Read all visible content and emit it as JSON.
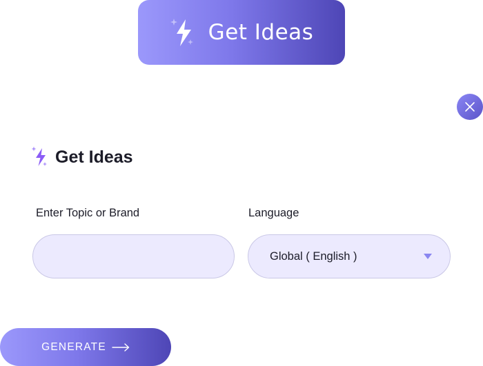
{
  "launcher": {
    "label": "Get Ideas",
    "icon": "sparkle-bolt-icon"
  },
  "close": {
    "icon": "close-icon"
  },
  "panel": {
    "title": "Get Ideas",
    "title_icon": "sparkle-bolt-icon"
  },
  "form": {
    "topic_label": "Enter Topic or Brand",
    "topic_value": "",
    "language_label": "Language",
    "language_value": "Global ( English )",
    "language_icon": "caret-down-icon"
  },
  "generate": {
    "label": "GENERATE",
    "icon": "arrow-right-icon"
  },
  "colors": {
    "gradient_start": "#9b98fb",
    "gradient_end": "#4e46b6",
    "field_bg": "#eceafe",
    "field_border": "#c9c7e6",
    "accent_purple": "#8b5cf6",
    "text_dark": "#1c1c28"
  }
}
